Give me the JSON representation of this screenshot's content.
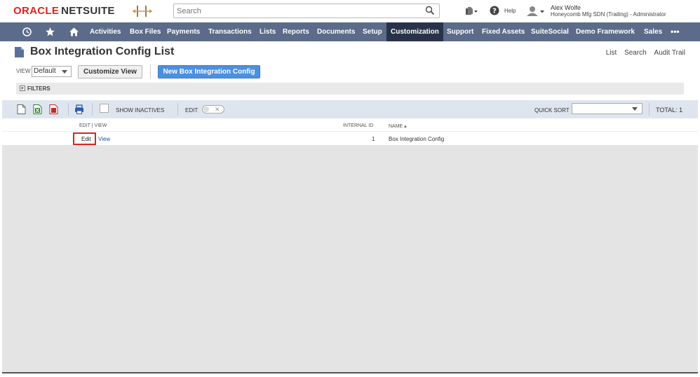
{
  "header": {
    "logo_oracle": "ORACLE",
    "logo_netsuite": "NETSUITE",
    "search_placeholder": "Search",
    "help_label": "Help",
    "user_name": "Alex Wolfe",
    "user_role": "Honeycomb Mfg SDN (Trailing) - Administrator"
  },
  "nav": {
    "items": [
      "Activities",
      "Box Files",
      "Payments",
      "Transactions",
      "Lists",
      "Reports",
      "Documents",
      "Setup",
      "Customization",
      "Support",
      "Fixed Assets",
      "SuiteSocial",
      "Demo Framework",
      "Sales"
    ],
    "active": "Customization",
    "more": "•••"
  },
  "page": {
    "title": "Box Integration Config List",
    "links": [
      "List",
      "Search",
      "Audit Trail"
    ],
    "view_label": "VIEW",
    "view_value": "Default",
    "customize_button": "Customize View",
    "new_button": "New Box Integration Config",
    "filters_label": "FILTERS"
  },
  "list_toolbar": {
    "show_inactives": "SHOW INACTIVES",
    "edit_label": "EDIT",
    "toggle_glyph": "✕",
    "quick_sort_label": "QUICK SORT",
    "total": "TOTAL: 1"
  },
  "table": {
    "columns": [
      "EDIT | VIEW",
      "INTERNAL ID",
      "NAME ▴"
    ],
    "rows": [
      {
        "edit": "Edit",
        "view": "View",
        "internal_id": "1",
        "name": "Box Integration Config"
      }
    ]
  },
  "colors": {
    "nav_bg": "#5c6b8a",
    "nav_active": "#28334a",
    "primary_button": "#4b8fe0",
    "oracle_red": "#e2231a",
    "highlight_box": "#dd2222"
  }
}
